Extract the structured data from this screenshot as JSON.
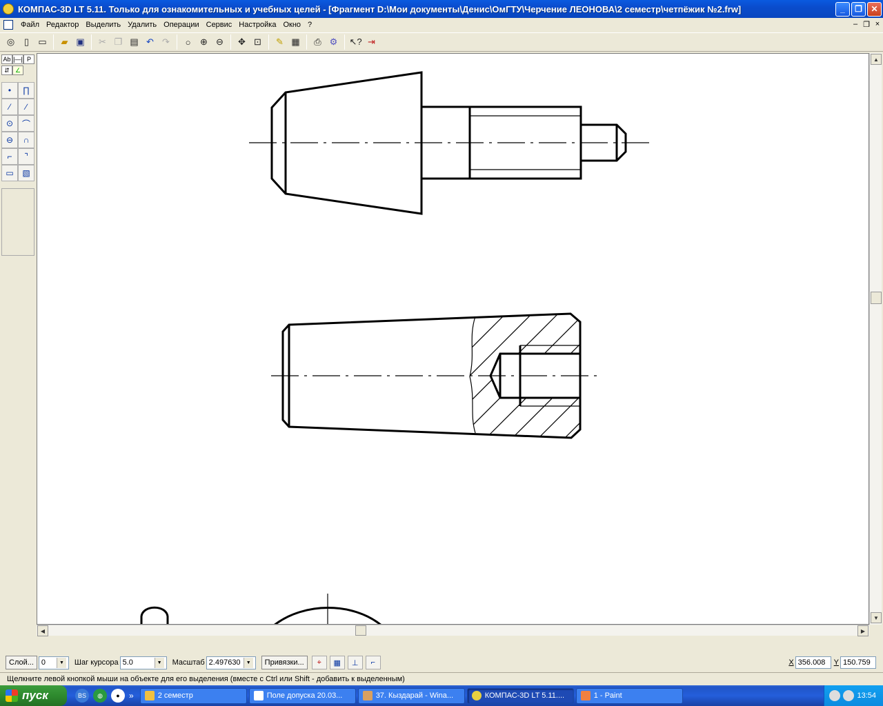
{
  "window": {
    "title": "КОМПАС-3D LT 5.11. Только для ознакомительных и учебных целей - [Фрагмент D:\\Мои документы\\Денис\\ОмГТУ\\Черчение ЛЕОНОВА\\2 семестр\\четпёжик №2.frw]",
    "minimize": "_",
    "maximize": "❐",
    "close": "✕"
  },
  "menu": {
    "items": [
      "Файл",
      "Редактор",
      "Выделить",
      "Удалить",
      "Операции",
      "Сервис",
      "Настройка",
      "Окно",
      "?"
    ],
    "mdi": [
      "–",
      "❐",
      "×"
    ]
  },
  "toolbar": {
    "icons": [
      "print-preview",
      "new-document",
      "new-fragment",
      "open",
      "save",
      "cut",
      "copy",
      "paste",
      "undo",
      "redo",
      "zoom",
      "zoom-in",
      "zoom-out",
      "pan",
      "zoom-fit",
      "refresh",
      "layers",
      "print",
      "settings",
      "help",
      "exit"
    ]
  },
  "left_panel": {
    "tabs": [
      "Ab",
      "|—|",
      "P"
    ]
  },
  "params": {
    "layer_button": "Слой...",
    "layer_value": "0",
    "step_label": "Шаг курсора",
    "step_value": "5.0",
    "scale_label": "Масштаб",
    "scale_value": "2.497630",
    "snap_button": "Привязки...",
    "x_label": "X",
    "x_value": "356.008",
    "y_label": "Y",
    "y_value": "150.759"
  },
  "status": {
    "hint": "Щелкните левой кнопкой мыши на объекте для его выделения (вместе с Ctrl или Shift - добавить к выделенным)"
  },
  "taskbar": {
    "start": "пуск",
    "more": "»",
    "tasks": [
      {
        "label": "2 семестр",
        "color": "#f0c040"
      },
      {
        "label": "Поле допуска 20.03...",
        "color": "#ffffff"
      },
      {
        "label": "37. Кыздарай - Wina...",
        "color": "#d8a060"
      },
      {
        "label": "КОМПАС-3D LT 5.11....",
        "color": "#e8d040"
      },
      {
        "label": "1 - Paint",
        "color": "#f08040"
      }
    ],
    "clock": "13:54"
  }
}
